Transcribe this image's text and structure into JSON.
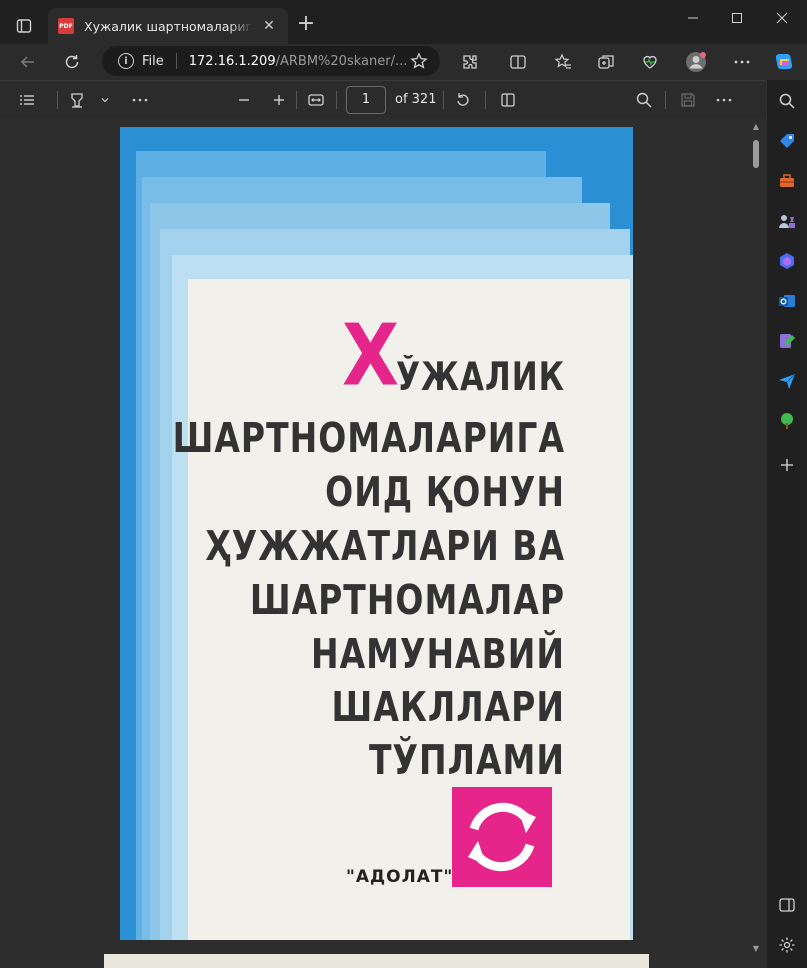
{
  "browser": {
    "tab_title": "Хужалик шартномаларига оид қ",
    "url_scheme": "File",
    "url_host": "172.16.1.209",
    "url_path": "/ARBM%20skaner/..."
  },
  "pdf_toolbar": {
    "current_page": "1",
    "page_total": "of 321"
  },
  "document": {
    "big_letter": "Х",
    "title_lines": [
      "ЎЖАЛИК",
      "ШАРТНОМАЛАРИГА",
      "ОИД ҚОНУН",
      "ҲУЖЖАТЛАРИ ВА",
      "ШАРТНОМАЛАР",
      "НАМУНАВИЙ",
      "ШАКЛЛАРИ",
      "ТЎПЛАМИ"
    ],
    "publisher": "\"АДОЛАТ\""
  },
  "colors": {
    "cover_blue": "#2a8fd3",
    "accent_pink": "#e6258b"
  }
}
